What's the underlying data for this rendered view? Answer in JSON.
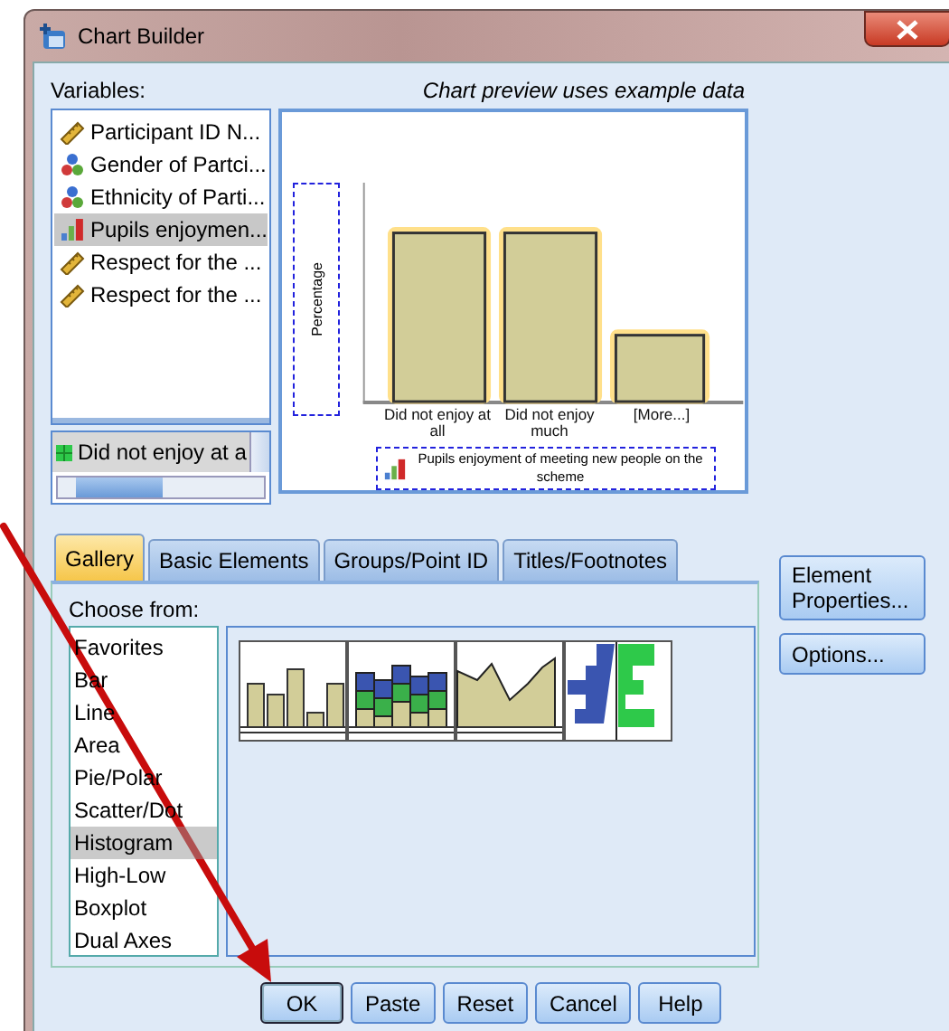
{
  "window": {
    "title": "Chart Builder"
  },
  "variables": {
    "label": "Variables:",
    "items": [
      {
        "label": "Participant ID N...",
        "kind": "scale",
        "selected": false
      },
      {
        "label": "Gender of Partci...",
        "kind": "nominal",
        "selected": false
      },
      {
        "label": "Ethnicity of Parti...",
        "kind": "nominal",
        "selected": false
      },
      {
        "label": "Pupils enjoymen...",
        "kind": "ordinal",
        "selected": true
      },
      {
        "label": "Respect for the ...",
        "kind": "scale",
        "selected": false
      },
      {
        "label": "Respect for the ...",
        "kind": "scale",
        "selected": false
      }
    ]
  },
  "categories": {
    "items": [
      {
        "label": "Did not enjoy at a",
        "selected": true
      }
    ]
  },
  "preview": {
    "note": "Chart preview uses example data",
    "y_label": "Percentage",
    "categories": [
      "Did not enjoy at all",
      "Did not enjoy much",
      "[More...]"
    ],
    "x_label": "Pupils enjoyment of meeting new people on the scheme"
  },
  "tabs": [
    {
      "label": "Gallery",
      "selected": true
    },
    {
      "label": "Basic Elements",
      "selected": false
    },
    {
      "label": "Groups/Point ID",
      "selected": false
    },
    {
      "label": "Titles/Footnotes",
      "selected": false
    }
  ],
  "gallery": {
    "label": "Choose from:",
    "items": [
      {
        "label": "Favorites",
        "selected": false
      },
      {
        "label": "Bar",
        "selected": false
      },
      {
        "label": "Line",
        "selected": false
      },
      {
        "label": "Area",
        "selected": false
      },
      {
        "label": "Pie/Polar",
        "selected": false
      },
      {
        "label": "Scatter/Dot",
        "selected": false
      },
      {
        "label": "Histogram",
        "selected": true
      },
      {
        "label": "High-Low",
        "selected": false
      },
      {
        "label": "Boxplot",
        "selected": false
      },
      {
        "label": "Dual Axes",
        "selected": false
      }
    ],
    "thumbnails": [
      {
        "kind": "simple"
      },
      {
        "kind": "stacked"
      },
      {
        "kind": "frequency"
      },
      {
        "kind": "pyramid"
      }
    ]
  },
  "side_buttons": [
    "Element Properties...",
    "Options..."
  ],
  "buttons": [
    {
      "label": "OK",
      "default": true
    },
    {
      "label": "Paste",
      "default": false
    },
    {
      "label": "Reset",
      "default": false
    },
    {
      "label": "Cancel",
      "default": false
    },
    {
      "label": "Help",
      "default": false
    }
  ]
}
